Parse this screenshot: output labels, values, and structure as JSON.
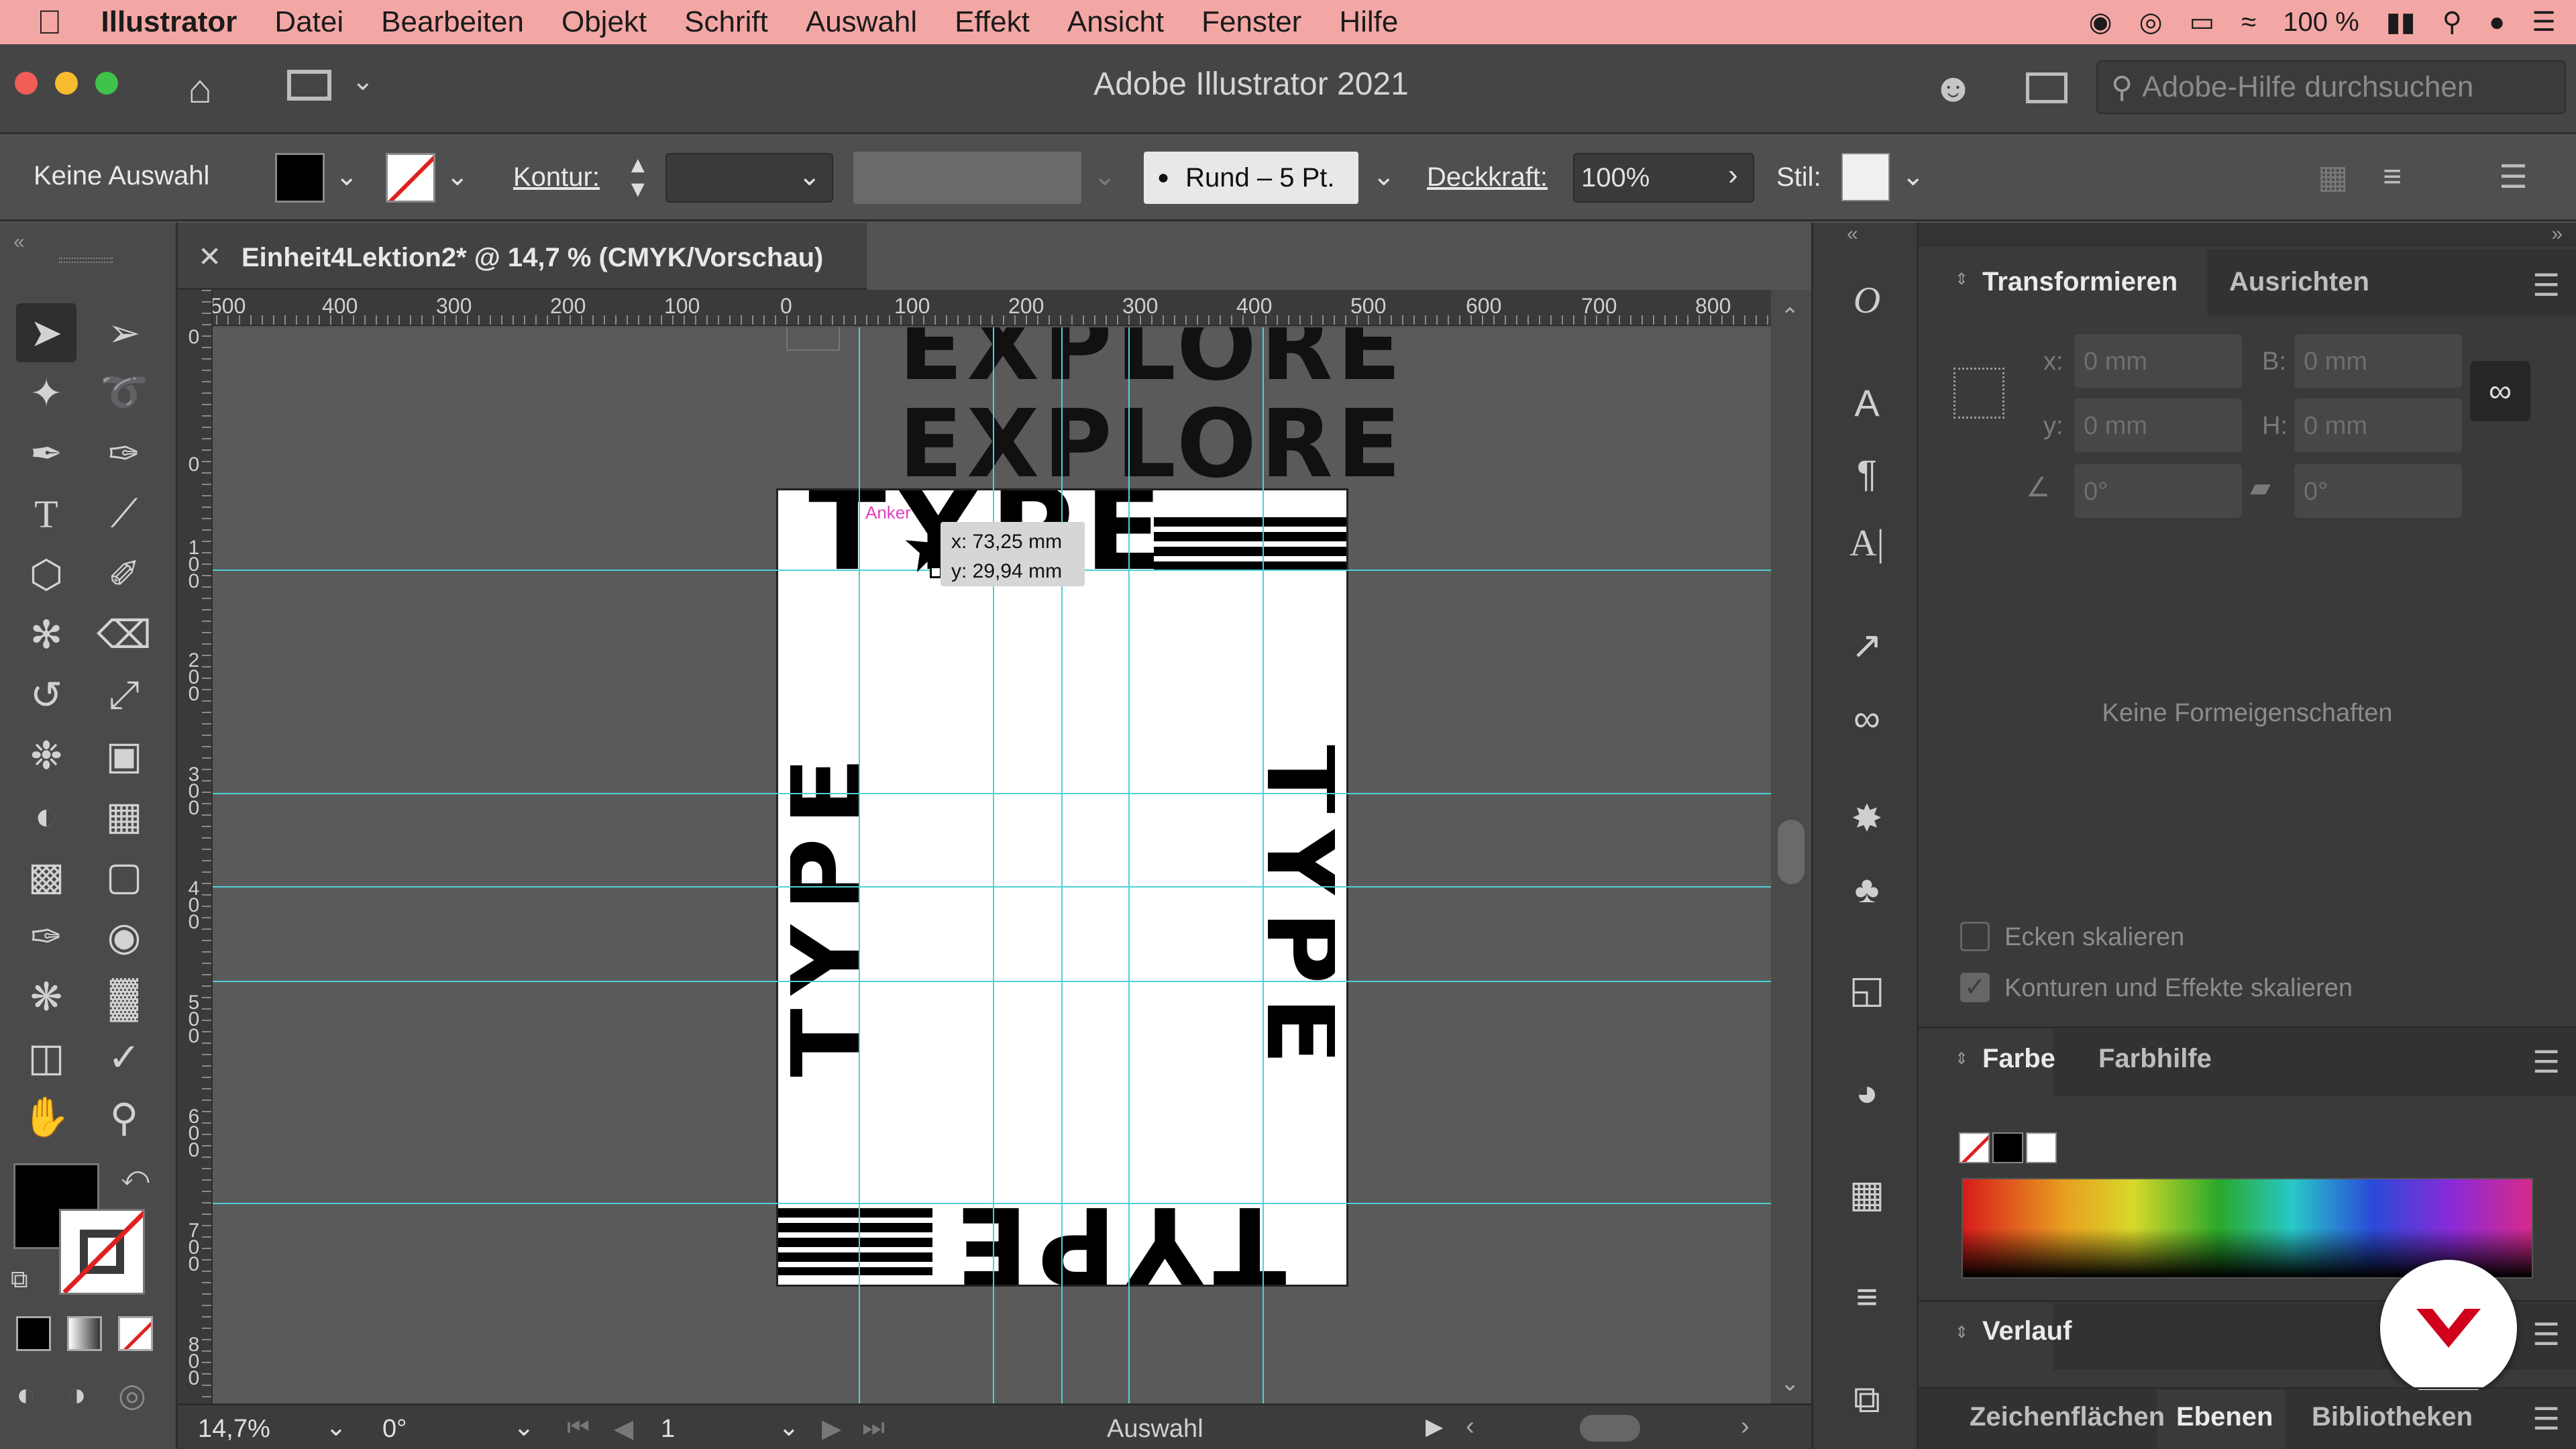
{
  "menubar": {
    "app": "Illustrator",
    "items": [
      "Datei",
      "Bearbeiten",
      "Objekt",
      "Schrift",
      "Auswahl",
      "Effekt",
      "Ansicht",
      "Fenster",
      "Hilfe"
    ],
    "battery": "100 %"
  },
  "window": {
    "title": "Adobe Illustrator 2021",
    "search_placeholder": "Adobe-Hilfe durchsuchen"
  },
  "control": {
    "selection": "Keine Auswahl",
    "kontur_label": "Kontur:",
    "brush": "Rund – 5 Pt.",
    "opacity_label": "Deckkraft:",
    "opacity_value": "100%",
    "style_label": "Stil:"
  },
  "document": {
    "tab_title": "Einheit4Lektion2* @ 14,7 % (CMYK/Vorschau)"
  },
  "rulers": {
    "h_labels": [
      "500",
      "400",
      "300",
      "200",
      "100",
      "0",
      "100",
      "200",
      "300",
      "400",
      "500",
      "600",
      "700",
      "800"
    ],
    "v_labels": [
      "0",
      "0",
      "1 0 0",
      "2 0 0",
      "3 0 0",
      "4 0 0",
      "5 0 0",
      "6 0 0",
      "7 0 0",
      "8 0 0"
    ]
  },
  "artwork": {
    "header_top": "EXPLORE",
    "header": "EXPLORE",
    "type_word": "TYPE",
    "anchor_hint": "Anker",
    "coord_x": "x: 73,25 mm",
    "coord_y": "y: 29,94 mm"
  },
  "status": {
    "zoom": "14,7%",
    "angle": "0°",
    "artboard": "1",
    "tool": "Auswahl"
  },
  "transform_panel": {
    "tab_active": "Transformieren",
    "tab_other": "Ausrichten",
    "x_label": "x:",
    "x_value": "0 mm",
    "y_label": "y:",
    "y_value": "0 mm",
    "w_label": "B:",
    "w_value": "0 mm",
    "h_label": "H:",
    "h_value": "0 mm",
    "angle_value": "0°",
    "shear_value": "0°",
    "empty_text": "Keine Formeigenschaften",
    "scale_corners": "Ecken skalieren",
    "scale_strokes": "Konturen und Effekte skalieren",
    "scale_corners_checked": false,
    "scale_strokes_checked": true
  },
  "color_panel": {
    "tab_active": "Farbe",
    "tab_other": "Farbhilfe"
  },
  "gradient_panel": {
    "tab_active": "Verlauf"
  },
  "bottom_tabs": [
    "Zeichenflächen",
    "Ebenen",
    "Bibliotheken"
  ],
  "bottom_tab_active": "Ebenen",
  "colors": {
    "menubar": "#f3a7a4",
    "guide": "#4fd0d6",
    "badge": "#d0021b"
  }
}
